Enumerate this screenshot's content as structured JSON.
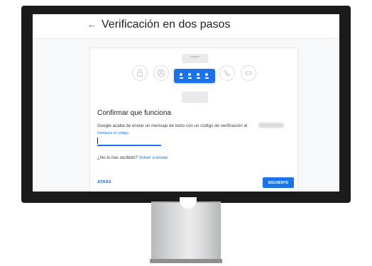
{
  "header": {
    "back_icon": "←",
    "title": "Verificación en dos pasos"
  },
  "illustration": {
    "left_icons": [
      "lock-icon",
      "person-icon"
    ],
    "right_icons": [
      "phone-icon",
      "key-icon"
    ],
    "bubble_digits": 4
  },
  "card": {
    "heading": "Confirmar que funciona",
    "description": "Google acaba de enviar un mensaje de texto con un código de verificación al",
    "code_field": {
      "label": "Introduce el código",
      "value": ""
    },
    "resend": {
      "text": "¿No lo has recibido?",
      "link": "Volver a enviar"
    },
    "back_button": "ATRÁS",
    "next_button": "SIGUIENTE"
  },
  "colors": {
    "accent": "#1a73e8",
    "bezel": "#1b1b1b",
    "screen_background": "#f7f8fa"
  }
}
